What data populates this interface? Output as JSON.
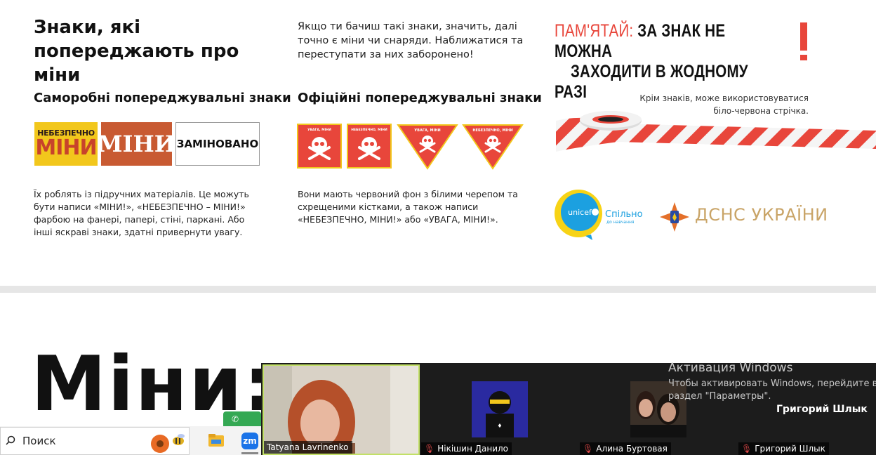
{
  "header": {
    "title": "Знаки, які попереджають про міни",
    "intro": "Якщо ти бачиш такі знаки, значить, далі точно є міни чи снаряди. Наближатися та переступати за них заборонено!",
    "remember_label": "ПАМ'ЯТАЙ:",
    "remember_text_1": "ЗА ЗНАК НЕ МОЖНА",
    "remember_text_2": "ЗАХОДИТИ В ЖОДНОМУ РАЗІ"
  },
  "homemade": {
    "title": "Саморобні попереджувальні знаки",
    "sign1_top": "НЕБЕЗПЕЧНО",
    "sign1_bottom": "МІНИ",
    "sign2": "МІНИ",
    "sign3": "ЗАМІНОВАНО",
    "description": "Їх роблять із підручних матеріалів. Це можуть бути написи «МІНИ!», «НЕБЕЗПЕЧНО – МІНИ!» фарбою на фанері, папері, стіні, паркані. Або інші яскраві знаки, здатні привернути увагу."
  },
  "official": {
    "title": "Офіційні попереджувальні знаки",
    "sign1": "УВАГА, МІНИ",
    "sign2": "НЕБЕЗПЕЧНО, МІНИ",
    "sign3": "УВАГА, МІНИ",
    "sign4": "НЕБЕЗПЕЧНО, МІНИ",
    "description": "Вони мають червоний фон з білими черепом та схрещеними кістками, а також написи «НЕБЕЗПЕЧНО, МІНИ!» або «УВАГА, МІНИ!»."
  },
  "tape": {
    "note": "Крім знаків, може використовуватися біло-червона стрічка."
  },
  "logos": {
    "unicef": "unicef",
    "spilno": "Спільно",
    "spilno_sub": "до навчання",
    "dsns": "ДСНС УКРАЇНИ"
  },
  "big_heading": "Міни:",
  "taskbar": {
    "search_placeholder": "Поиск",
    "zoom_label": "zm"
  },
  "zoom": {
    "participants": [
      {
        "name": "Tatyana Lavrinenko",
        "muted": false
      },
      {
        "name": "Нікішин Данило",
        "muted": true
      },
      {
        "name": "Алина Буртовая",
        "muted": true
      },
      {
        "name": "Григорий Шлык",
        "muted": true
      }
    ],
    "speaker_label": "Григорий Шлык"
  },
  "windows_activation": {
    "title": "Активация Windows",
    "line1": "Чтобы активировать Windows, перейдите в",
    "line2": "раздел \"Параметры\"."
  },
  "colors": {
    "accent_red": "#e8463b",
    "yellow": "#f2c71c",
    "unicef_blue": "#1ca0e0",
    "dsns_gold": "#c9a467"
  }
}
